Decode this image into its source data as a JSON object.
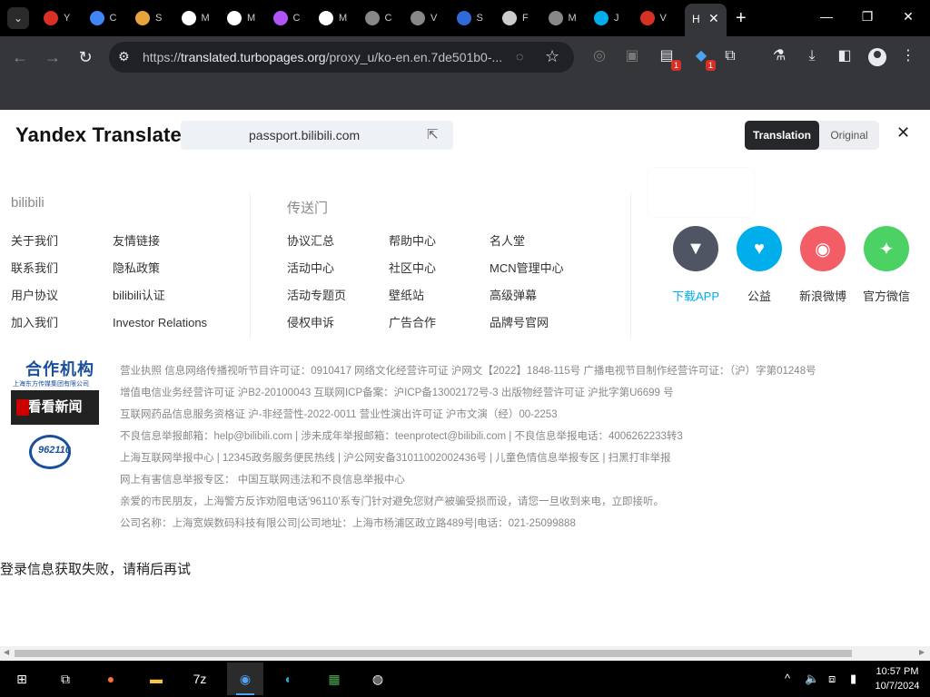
{
  "browser": {
    "tabs": [
      {
        "title": "Y",
        "icon": "bookmark-icon",
        "color": "#d93025"
      },
      {
        "title": "C",
        "icon": "search-icon",
        "color": "#4285f4"
      },
      {
        "title": "S",
        "icon": "image-icon",
        "color": "#e8a33d"
      },
      {
        "title": "M",
        "icon": "openai-icon",
        "color": "#ffffff"
      },
      {
        "title": "M",
        "icon": "openai-icon",
        "color": "#ffffff"
      },
      {
        "title": "C",
        "icon": "circle-icon",
        "color": "#b054f7"
      },
      {
        "title": "M",
        "icon": "openai-icon",
        "color": "#ffffff"
      },
      {
        "title": "C",
        "icon": "openai-icon",
        "color": "#888888"
      },
      {
        "title": "V",
        "icon": "globe-icon",
        "color": "#888888"
      },
      {
        "title": "S",
        "icon": "cloud-icon",
        "color": "#2f6bd8"
      },
      {
        "title": "F",
        "icon": "bank-icon",
        "color": "#cccccc"
      },
      {
        "title": "M",
        "icon": "globe-icon",
        "color": "#888888"
      },
      {
        "title": "J",
        "icon": "tv-icon",
        "color": "#00aeec"
      },
      {
        "title": "V",
        "icon": "wiki-icon",
        "color": "#d93025"
      },
      {
        "title": "H",
        "icon": "tab-icon",
        "color": "#ffffff"
      }
    ],
    "active_tab_title": "H",
    "url_prefix": "https://",
    "url_host": "translated.turbopages.org",
    "url_rest": "/proxy_u/ko-en.en.7de501b0-...",
    "ext_badge_1": "1",
    "ext_badge_2": "1"
  },
  "yandex": {
    "logo": "Yandex Translate",
    "source_host": "passport.bilibili.com",
    "toggle_translation": "Translation",
    "toggle_original": "Original"
  },
  "footer": {
    "col1_title": "bilibili",
    "col1_links": [
      "关于我们",
      "联系我们",
      "用户协议",
      "加入我们"
    ],
    "col1b_links": [
      "友情链接",
      "隐私政策",
      "bilibili认证",
      "Investor Relations"
    ],
    "col2_title": "传送门",
    "col2a_links": [
      "协议汇总",
      "活动中心",
      "活动专题页",
      "侵权申诉"
    ],
    "col2b_links": [
      "帮助中心",
      "社区中心",
      "壁纸站",
      "广告合作"
    ],
    "col2c_links": [
      "名人堂",
      "MCN管理中心",
      "高级弹幕",
      "品牌号官网"
    ],
    "social": [
      {
        "label": "下载APP",
        "icon": "download-app-icon",
        "color": "#505563"
      },
      {
        "label": "公益",
        "icon": "charity-heart-icon",
        "color": "#00aeec"
      },
      {
        "label": "新浪微博",
        "icon": "weibo-icon",
        "color": "#f25d66"
      },
      {
        "label": "官方微信",
        "icon": "wechat-icon",
        "color": "#4cd264"
      }
    ],
    "download_label_color": "#00aeec",
    "logo_partner_title": "合作机构",
    "logo_partner_sub": "上海东方传媒集团有限公司",
    "logo_kankan": "看看新闻",
    "logo_96110": "962110",
    "license_lines": [
      "营业执照    信息网络传播视听节目许可证：0910417    网络文化经营许可证 沪网文【2022】1848-115号    广播电视节目制作经营许可证：（沪）字第01248号",
      "增值电信业务经营许可证 沪B2-20100043    互联网ICP备案：沪ICP备13002172号-3    出版物经营许可证 沪批字第U6699 号",
      "互联网药品信息服务资格证 沪-非经营性-2022-0011    营业性演出许可证 沪市文演（经）00-2253",
      "不良信息举报邮箱：help@bilibili.com | 涉未成年举报邮箱：teenprotect@bilibili.com | 不良信息举报电话：4006262233转3",
      "上海互联网举报中心 | 12345政务服务便民热线 |  沪公网安备31011002002436号 | 儿童色情信息举报专区 | 扫黑打非举报",
      "网上有害信息举报专区：  中国互联网违法和不良信息举报中心",
      "亲爱的市民朋友，上海警方反诈劝阻电话'96110'系专门针对避免您财产被骗受损而设，请您一旦收到来电，立即接听。",
      "公司名称：上海宽娱数码科技有限公司|公司地址：上海市杨浦区政立路489号|电话：021-25099888"
    ],
    "login_error": "登录信息获取失败，请稍后再试"
  },
  "taskbar": {
    "time": "10:57 PM",
    "date": "10/7/2024",
    "apps": [
      "windows-start-icon",
      "task-view-icon",
      "firefox-icon",
      "file-explorer-icon",
      "7zip-icon",
      "chrome-icon",
      "edge-icon",
      "installer-icon",
      "obs-icon"
    ]
  }
}
